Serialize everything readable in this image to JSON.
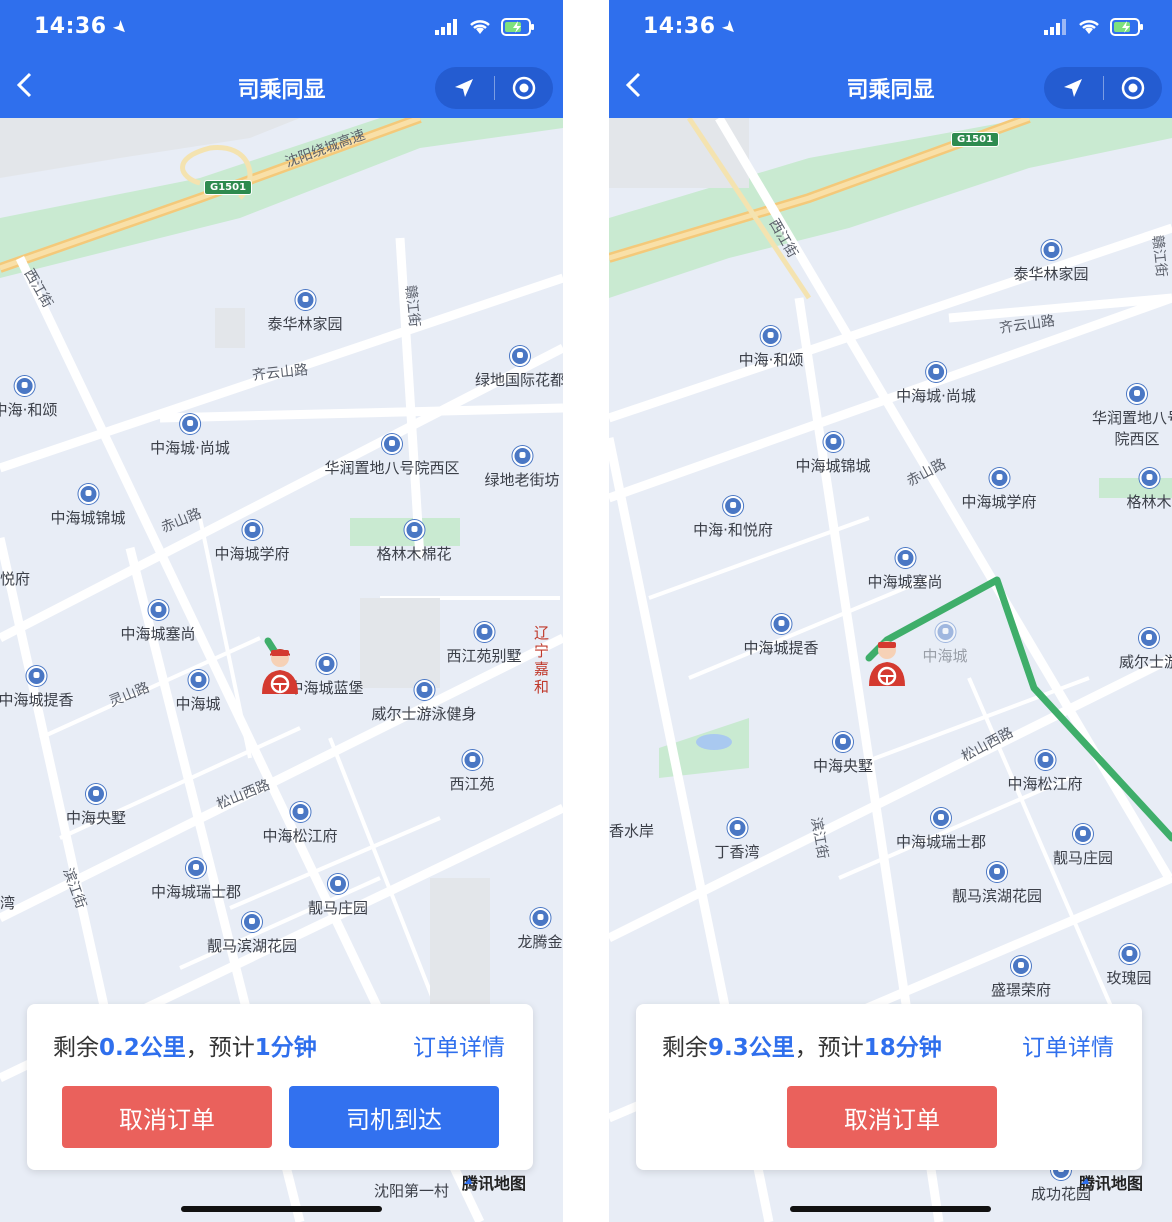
{
  "screens": [
    {
      "status_bar": {
        "time": "14:36"
      },
      "header": {
        "title": "司乘同显"
      },
      "map": {
        "highway_label": "沈阳绕城高速",
        "highway_shield": "G1501",
        "road_labels": [
          "西江街",
          "齐云山路",
          "赤山路",
          "灵山路",
          "松山西路",
          "滨江街",
          "赣江街"
        ],
        "pois": [
          "泰华林家园",
          "绿地国际花都",
          "中海·和颂",
          "中海城·尚城",
          "华润置地八号院西区",
          "绿地老街坊",
          "中海城锦城",
          "中海城学府",
          "格林木棉花",
          "悦府",
          "中海城塞尚",
          "西江苑别墅",
          "中海城蓝堡",
          "中海城提香",
          "中海城",
          "威尔士游泳健身",
          "西江苑",
          "中海央墅",
          "中海松江府",
          "中海城瑞士郡",
          "靓马庄园",
          "湾",
          "靓马滨湖花园",
          "龙腾金",
          "辽宁嘉和",
          "沈阳第一村"
        ],
        "brand": "腾讯地图"
      },
      "info_card": {
        "remain_prefix": "剩余",
        "distance": "0.2公里",
        "mid": "，预计",
        "eta": "1分钟",
        "detail_link": "订单详情",
        "cancel_button": "取消订单",
        "arrive_button": "司机到达"
      }
    },
    {
      "status_bar": {
        "time": "14:36"
      },
      "header": {
        "title": "司乘同显"
      },
      "map": {
        "highway_shield": "G1501",
        "road_labels": [
          "西江街",
          "齐云山路",
          "赤山路",
          "松山西路",
          "滨江街",
          "赣江街"
        ],
        "pois": [
          "泰华林家园",
          "中海·和颂",
          "中海城·尚城",
          "华润置地八号院西区",
          "中海城锦城",
          "中海城学府",
          "格林木",
          "中海·和悦府",
          "中海城塞尚",
          "中海城提香",
          "中海城",
          "威尔士游",
          "中海央墅",
          "中海松江府",
          "香水岸",
          "丁香湾",
          "中海城瑞士郡",
          "靓马庄园",
          "靓马滨湖花园",
          "盛璟荣府",
          "玫瑰园",
          "成功花园"
        ],
        "brand": "腾讯地图"
      },
      "info_card": {
        "remain_prefix": "剩余",
        "distance": "9.3公里",
        "mid": "，预计",
        "eta": "18分钟",
        "detail_link": "订单详情",
        "cancel_button": "取消订单"
      }
    }
  ],
  "colors": {
    "header": "#2f6fed",
    "route": "#3fae6a",
    "cancel": "#ea615c",
    "confirm": "#3271ef"
  }
}
